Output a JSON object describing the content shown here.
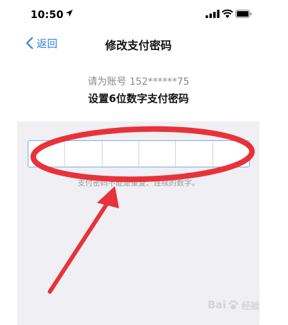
{
  "status_bar": {
    "time": "10:50",
    "icons": [
      "location-arrow-icon",
      "signal-icon",
      "wifi-icon",
      "battery-icon"
    ]
  },
  "nav": {
    "back_label": "返回",
    "title": "修改支付密码"
  },
  "content": {
    "account_hint": "请为账号 152******75",
    "instruction": "设置6位数字支付密码",
    "pin_cells": 6,
    "pin_rule": "支付密码不能是重复、连续的数字。"
  },
  "colors": {
    "accent": "#2f7fe6",
    "annotation": "#e8323a",
    "background": "#efeff4"
  },
  "watermark": {
    "brand_left": "Bai",
    "brand_right": "经验"
  }
}
